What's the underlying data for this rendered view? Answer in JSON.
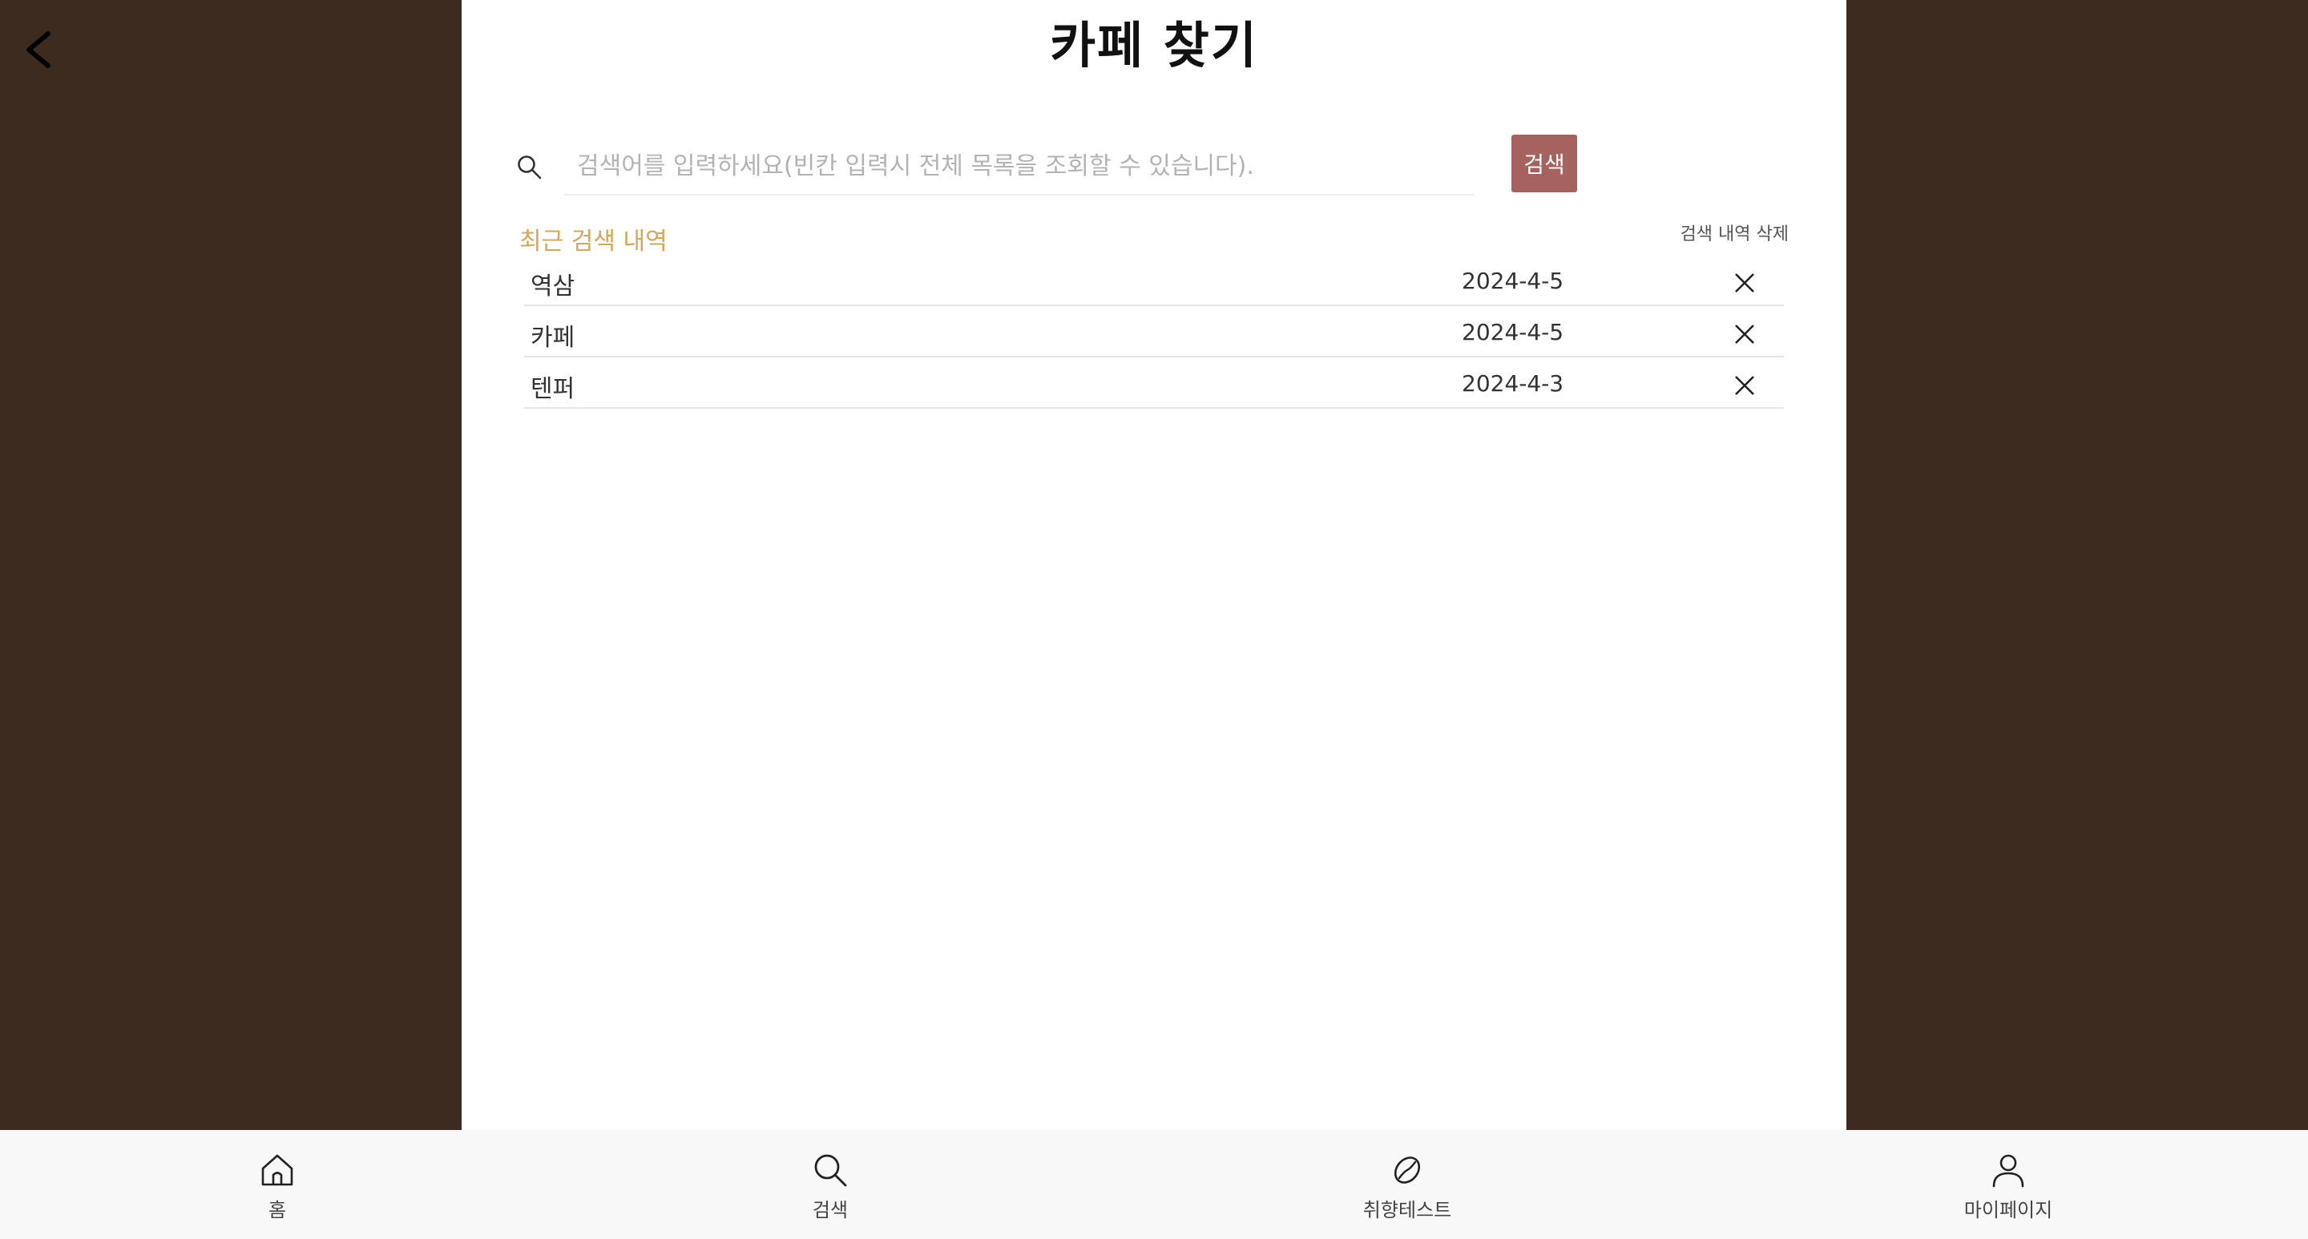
{
  "header": {
    "title": "카페 찾기",
    "back_icon": "chevron-left-icon"
  },
  "search": {
    "placeholder": "검색어를 입력하세요(빈칸 입력시 전체 목록을 조회할 수 있습니다).",
    "value": "",
    "button_label": "검색",
    "icon": "search-icon"
  },
  "recent": {
    "title": "최근 검색 내역",
    "clear_label": "검색 내역 삭제",
    "items": [
      {
        "term": "역삼",
        "date": "2024-4-5"
      },
      {
        "term": "카페",
        "date": "2024-4-5"
      },
      {
        "term": "텐퍼",
        "date": "2024-4-3"
      }
    ]
  },
  "nav": {
    "items": [
      {
        "label": "홈",
        "icon": "home-icon"
      },
      {
        "label": "검색",
        "icon": "search-icon"
      },
      {
        "label": "취향테스트",
        "icon": "coffee-bean-icon"
      },
      {
        "label": "마이페이지",
        "icon": "user-icon"
      }
    ]
  },
  "colors": {
    "background": "#3d2b1f",
    "panel": "#ffffff",
    "accent_button": "#a5625e",
    "recent_title": "#d4a85a",
    "nav_bar": "#f8f8f8"
  }
}
